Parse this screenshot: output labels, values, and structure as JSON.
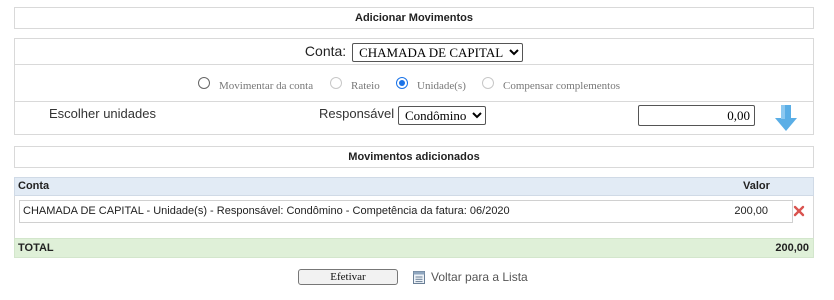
{
  "add_section": {
    "title": "Adicionar Movimentos",
    "conta_label": "Conta:",
    "conta_selected": "CHAMADA DE CAPITAL",
    "radio_options": [
      {
        "label": "Movimentar da conta",
        "checked": false,
        "disabled": false
      },
      {
        "label": "Rateio",
        "checked": false,
        "disabled": true
      },
      {
        "label": "Unidade(s)",
        "checked": true,
        "disabled": false
      },
      {
        "label": "Compensar complementos",
        "checked": false,
        "disabled": true
      }
    ],
    "escolher_label": "Escolher unidades",
    "responsavel_label": "Responsável",
    "responsavel_selected": "Condômino",
    "valor_input": "0,00",
    "add_icon": "arrow-down-icon"
  },
  "movements_section": {
    "title": "Movimentos adicionados",
    "columns": {
      "conta": "Conta",
      "valor": "Valor"
    },
    "rows": [
      {
        "description": "CHAMADA DE CAPITAL - Unidade(s) - Responsável: Condômino - Competência da fatura: 06/2020",
        "value": "200,00",
        "delete_icon": "delete-x-icon"
      }
    ],
    "total_label": "TOTAL",
    "total_value": "200,00"
  },
  "footer": {
    "efetivar_label": "Efetivar",
    "voltar_label": "Voltar para a Lista",
    "list_icon": "list-icon"
  },
  "colors": {
    "accent_radio": "#1a73e8",
    "header_bg": "#e2ebf5",
    "total_bg": "#dff0d8",
    "arrow_blue": "#5aaee6",
    "delete_red": "#d9534f"
  }
}
